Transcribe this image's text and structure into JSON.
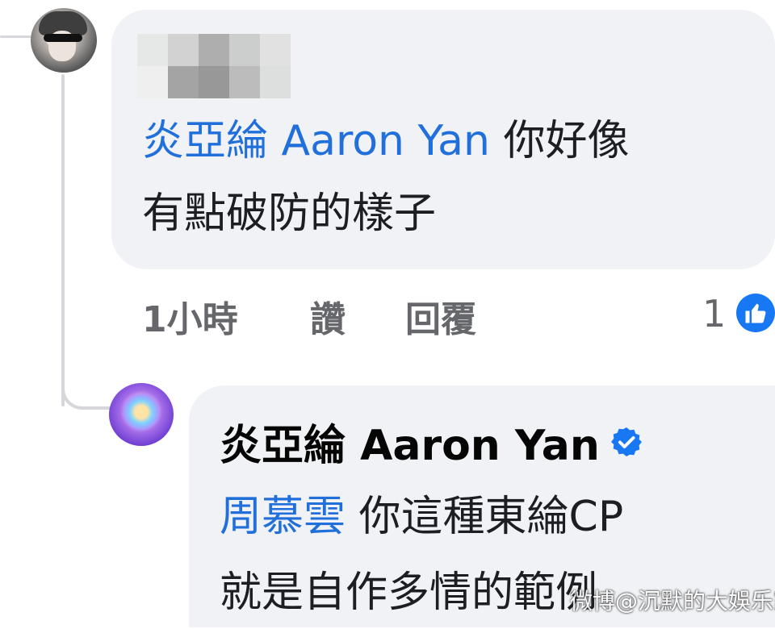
{
  "comment_1": {
    "mention": "炎亞綸 Aaron Yan",
    "text_line_1": "你好像",
    "text_line_2": "有點破防的樣子",
    "time": "1小時",
    "like_label": "讚",
    "reply_label": "回覆",
    "reaction_count": "1",
    "reaction_icon": "thumbs-up-icon"
  },
  "comment_2": {
    "author": "炎亞綸 Aaron Yan",
    "verified_icon": "verified-badge-icon",
    "mention": "周慕雲",
    "text_line_1": "你這種東綸CP",
    "text_line_2": "就是自作多情的範例"
  },
  "watermark": "微博@沉默的大娛乐家",
  "colors": {
    "bubble": "#f0f2f5",
    "mention": "#216fdb",
    "meta": "#65676b",
    "like_blue": "#1877f2"
  }
}
